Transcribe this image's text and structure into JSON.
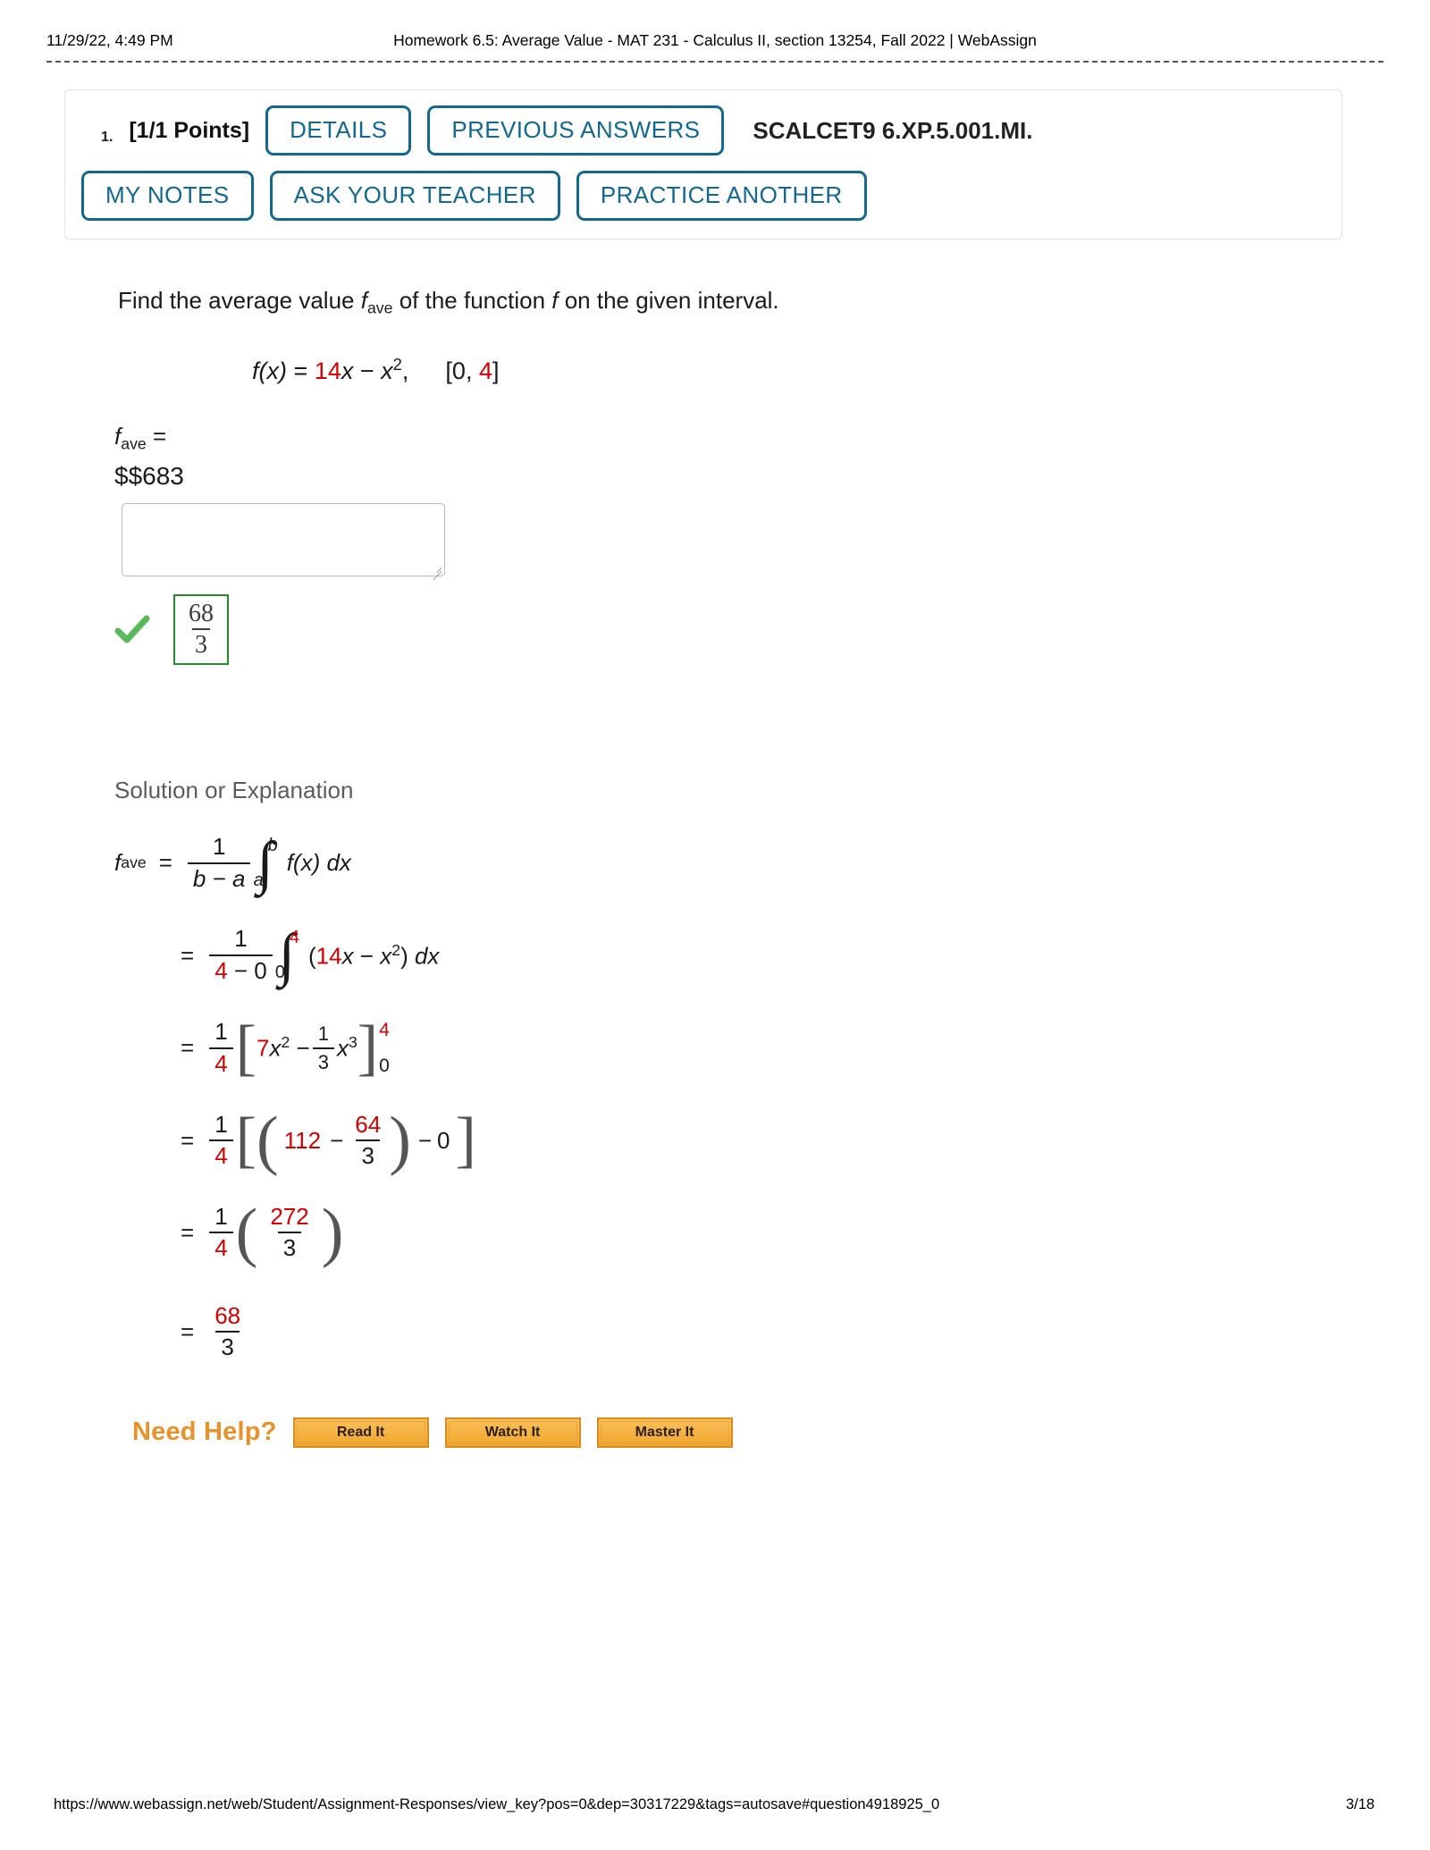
{
  "print_header": {
    "date": "11/29/22, 4:49 PM",
    "title": "Homework 6.5: Average Value - MAT 231 - Calculus II, section 13254, Fall 2022 | WebAssign"
  },
  "question": {
    "number": "1.",
    "points": "[1/1 Points]",
    "reference_code": "SCALCET9 6.XP.5.001.MI.",
    "buttons_row1": [
      "DETAILS",
      "PREVIOUS ANSWERS"
    ],
    "buttons_row2": [
      "MY NOTES",
      "ASK YOUR TEACHER",
      "PRACTICE ANOTHER"
    ]
  },
  "prompt": {
    "before": "Find the average value ",
    "f_italic": "f",
    "f_sub": "ave",
    "middle": " of the function ",
    "f2_italic": "f",
    "after": " on the given interval."
  },
  "function_line": {
    "fx": "f(x)",
    "equals": "=",
    "coefficient": "14",
    "term1_rest": "x",
    "minus": "−",
    "term2": "x",
    "term2_exp": "2",
    "comma": ",",
    "interval_open": "[0,",
    "interval_b": "4",
    "interval_close": "]"
  },
  "answer": {
    "label_f": "f",
    "label_sub": "ave",
    "label_eq": "=",
    "raw_text": "$$683",
    "input_value": "",
    "input_placeholder": "",
    "status_icon": "green-check-icon",
    "correct_numerator": "68",
    "correct_denominator": "3"
  },
  "solution": {
    "heading": "Solution or Explanation",
    "line1": {
      "lhs_f": "f",
      "lhs_sub": "ave",
      "eq": "=",
      "frac_top": "1",
      "frac_bot": "b − a",
      "int_hi": "b",
      "int_lo": "a",
      "integrand": "f(x) dx"
    },
    "line2": {
      "eq": "=",
      "frac_top": "1",
      "frac_bot_a": "4",
      "frac_bot_rest": " − 0",
      "int_hi": "4",
      "int_lo": "0",
      "open": "(",
      "coef": "14",
      "var": "x",
      "minus": "−",
      "term2": "x",
      "term2_exp": "2",
      "close": ")",
      "dx": "dx"
    },
    "line3": {
      "eq": "=",
      "frac_top": "1",
      "frac_bot": "4",
      "coef": "7",
      "var": "x",
      "var_exp": "2",
      "minus": "−",
      "in_frac_top": "1",
      "in_frac_bot": "3",
      "var2": "x",
      "var2_exp": "3",
      "eval_hi": "4",
      "eval_lo": "0"
    },
    "line4": {
      "eq": "=",
      "frac_top": "1",
      "frac_bot": "4",
      "value1": "112",
      "minus": "−",
      "frac2_top": "64",
      "frac2_bot": "3",
      "minus2": "−",
      "zero": "0"
    },
    "line5": {
      "eq": "=",
      "frac_top": "1",
      "frac_bot": "4",
      "frac2_top": "272",
      "frac2_bot": "3"
    },
    "line6": {
      "eq": "=",
      "frac_top": "68",
      "frac_bot": "3"
    }
  },
  "need_help": {
    "label": "Need Help?",
    "buttons": [
      "Read It",
      "Watch It",
      "Master It"
    ]
  },
  "print_footer": {
    "url": "https://www.webassign.net/web/Student/Assignment-Responses/view_key?pos=0&dep=30317229&tags=autosave#question4918925_0",
    "page": "3/18"
  },
  "colors": {
    "accent_blue": "#12688f",
    "math_red": "#d40000",
    "help_orange": "#e8922a",
    "correct_green": "#2a8a2a"
  }
}
